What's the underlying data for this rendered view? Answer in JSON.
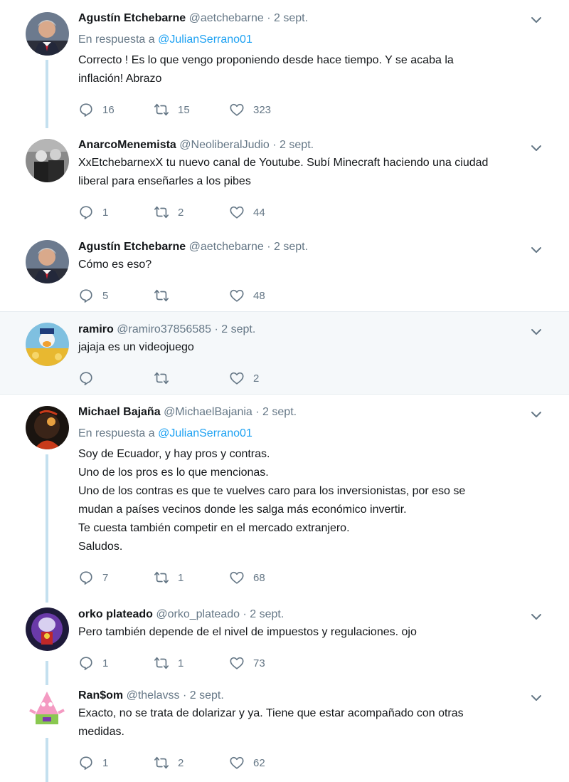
{
  "reply_prefix": "En respuesta a",
  "tweets": [
    {
      "name": "Agustín Etchebarne",
      "handle": "@aetchebarne",
      "time": "2 sept.",
      "reply_to": "@JulianSerrano01",
      "lines": [
        "Correcto ! Es lo que vengo proponiendo desde hace tiempo. Y se acaba la",
        "inflación! Abrazo"
      ],
      "replies": "16",
      "retweets": "15",
      "likes": "323"
    },
    {
      "name": "AnarcoMenemista",
      "handle": "@NeoliberalJudio",
      "time": "2 sept.",
      "lines": [
        "XxEtchebarnexX tu nuevo canal de Youtube. Subí Minecraft haciendo una ciudad",
        "liberal para enseñarles a los pibes"
      ],
      "replies": "1",
      "retweets": "2",
      "likes": "44"
    },
    {
      "name": "Agustín Etchebarne",
      "handle": "@aetchebarne",
      "time": "2 sept.",
      "lines": [
        "Cómo es eso?"
      ],
      "replies": "5",
      "retweets": "",
      "likes": "48"
    },
    {
      "name": "ramiro",
      "handle": "@ramiro37856585",
      "time": "2 sept.",
      "lines": [
        "jajaja es un videojuego"
      ],
      "replies": "",
      "retweets": "",
      "likes": "2"
    },
    {
      "name": "Michael Bajaña",
      "handle": "@MichaelBajania",
      "time": "2 sept.",
      "reply_to": "@JulianSerrano01",
      "lines": [
        "Soy de Ecuador, y hay pros y contras.",
        "Uno de los pros es lo que mencionas.",
        "Uno de los contras es que te vuelves caro para los inversionistas, por eso se",
        "mudan a países vecinos donde les salga más económico invertir.",
        "Te cuesta también competir en el mercado extranjero.",
        "Saludos."
      ],
      "replies": "7",
      "retweets": "1",
      "likes": "68"
    },
    {
      "name": "orko plateado",
      "handle": "@orko_plateado",
      "time": "2 sept.",
      "lines": [
        "Pero también depende de el nivel de impuestos y regulaciones. ojo"
      ],
      "replies": "1",
      "retweets": "1",
      "likes": "73"
    },
    {
      "name": "Ran$om",
      "handle": "@thelavss",
      "time": "2 sept.",
      "lines": [
        "Exacto, no se trata de dolarizar y ya. Tiene que estar acompañado con otras",
        "medidas."
      ],
      "replies": "1",
      "retweets": "2",
      "likes": "62"
    }
  ],
  "colors": {
    "link": "#1da1f2",
    "muted": "#657786",
    "thread_line": "#c4e0ef",
    "highlight_bg": "#f5f8fa"
  },
  "icons": {
    "reply": "reply-icon",
    "retweet": "retweet-icon",
    "like": "like-icon",
    "more": "chevron-down-icon"
  }
}
